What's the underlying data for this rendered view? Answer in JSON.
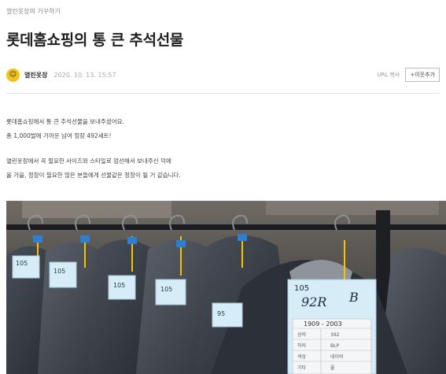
{
  "post": {
    "category": "열린옷장의 거꾸하기",
    "title": "롯데홈쇼핑의 통 큰 추석선물",
    "author": "열린옷장",
    "date": "2020. 10. 13. 15:57",
    "url_copy": "URL 복사",
    "add_neighbor": "+이웃추가"
  },
  "body": {
    "paragraphs": [
      "롯데홈쇼핑에서 통 큰 추석선물을 보내주셨어요.",
      "총 1,000벌에 가까운 남여 정장 492세트!",
      "열린옷장에서 꼭 필요한 사이즈와 스타일로 엄선해서 보내주신 덕에",
      "올 가을, 정장이 필요한 많은 분들에게 선물같은 정장이 될 거 같습니다."
    ]
  },
  "photo": {
    "tag_main": {
      "size": "105",
      "fit": "92R",
      "grade": "B",
      "code": "1909 - 2003",
      "rows": [
        [
          "상의",
          "392"
        ],
        [
          "하의",
          "BLP"
        ],
        [
          "색상",
          "네이비"
        ],
        [
          "기타",
          "울"
        ]
      ]
    },
    "small_tags": [
      "105",
      "105",
      "105",
      "105",
      "95"
    ]
  },
  "colors": {
    "avatar": "#f3c21a",
    "tag_blue": "#d6ecf7",
    "hanger_yellow": "#f5c400",
    "suit_gray": "#3a3f47"
  }
}
